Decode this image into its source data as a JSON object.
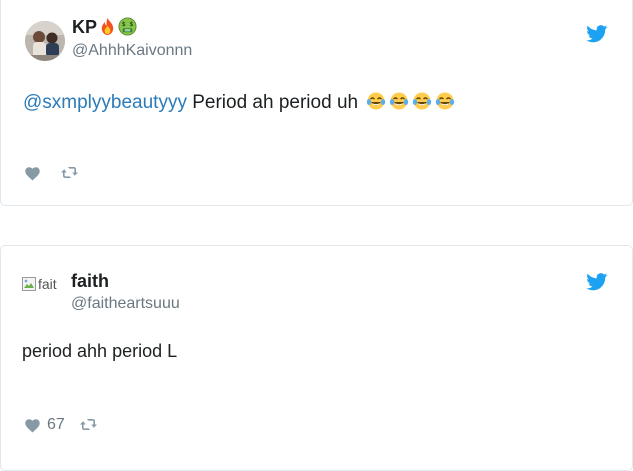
{
  "tweets": [
    {
      "display_name": "KP",
      "name_emojis": [
        "fire",
        "money-mouth-face"
      ],
      "screen_name": "@AhhhKaivonnn",
      "text": {
        "mention": "@sxmplyybeautyyy",
        "body": " Period ah period uh",
        "emojis": [
          "face-with-tears-of-joy",
          "face-with-tears-of-joy",
          "face-with-tears-of-joy",
          "face-with-tears-of-joy"
        ]
      },
      "like_count": "",
      "avatar_alt": ""
    },
    {
      "display_name": "faith",
      "name_emojis": [],
      "screen_name": "@faitheartsuuu",
      "text": {
        "mention": "",
        "body": "period ahh period L",
        "emojis": []
      },
      "like_count": "67",
      "avatar_alt": "fait"
    }
  ],
  "colors": {
    "twitter_blue": "#1da1f2",
    "mention_blue": "#2b7bb9",
    "muted_gray": "#697882",
    "icon_gray": "#8899a6",
    "border": "#e1e8ed"
  },
  "icons": [
    "twitter-bird-icon",
    "heart-icon",
    "retweet-icon"
  ]
}
